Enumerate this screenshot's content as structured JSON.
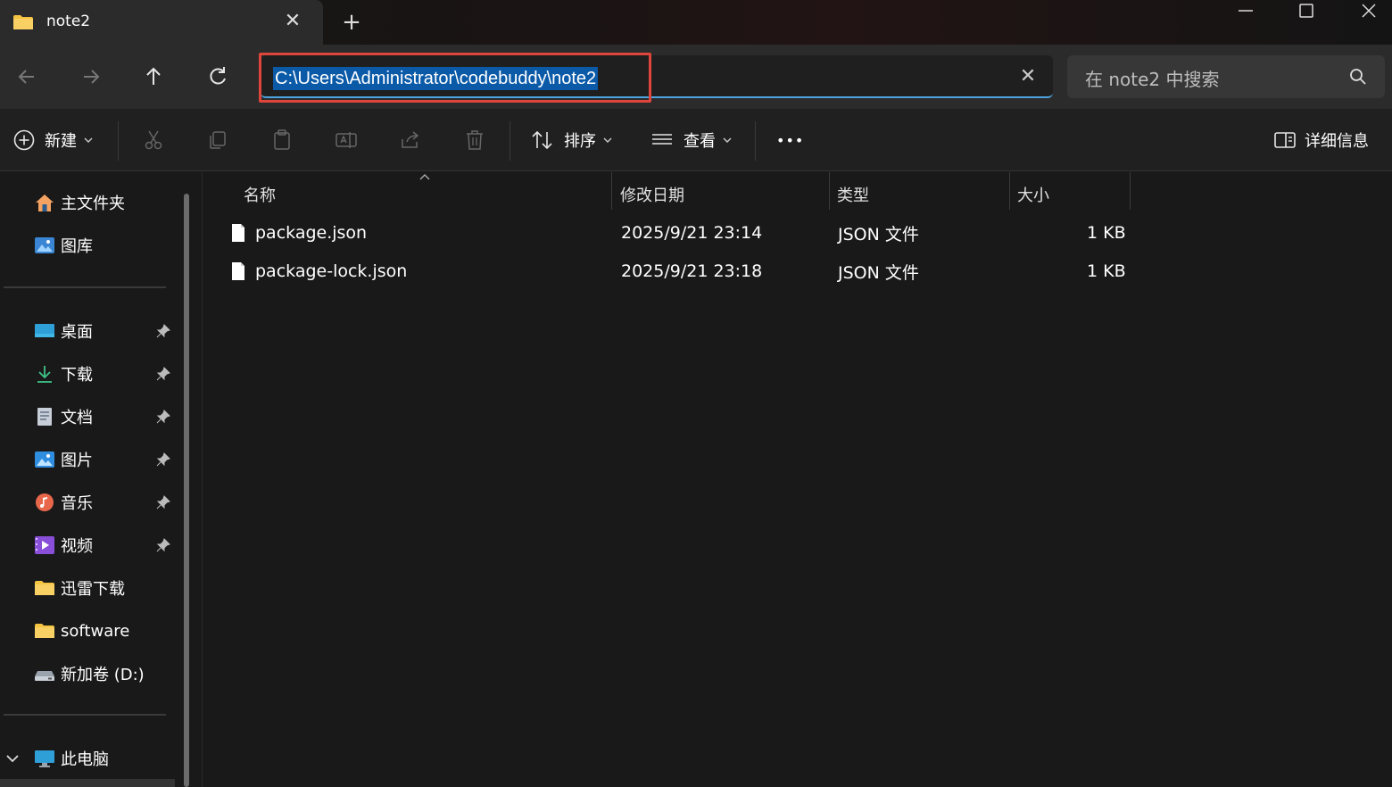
{
  "window": {
    "tab_title": "note2",
    "new_tab": "+",
    "tab_close": "✕"
  },
  "address": {
    "path": "C:\\Users\\Administrator\\codebuddy\\note2",
    "clear": "✕",
    "search_placeholder": "在 note2 中搜索"
  },
  "toolbar": {
    "new_label": "新建",
    "sort_label": "排序",
    "view_label": "查看",
    "more_label": "•••",
    "details_label": "详细信息"
  },
  "sidebar": {
    "quick": [
      {
        "label": "主文件夹",
        "icon": "home-icon"
      },
      {
        "label": "图库",
        "icon": "gallery-icon"
      }
    ],
    "pinned": [
      {
        "label": "桌面",
        "icon": "desktop-icon"
      },
      {
        "label": "下载",
        "icon": "download-icon"
      },
      {
        "label": "文档",
        "icon": "document-icon"
      },
      {
        "label": "图片",
        "icon": "pictures-icon"
      },
      {
        "label": "音乐",
        "icon": "music-icon"
      },
      {
        "label": "视频",
        "icon": "video-icon"
      }
    ],
    "folders": [
      {
        "label": "迅雷下载",
        "icon": "folder-icon"
      },
      {
        "label": "software",
        "icon": "folder-icon"
      },
      {
        "label": "新加卷 (D:)",
        "icon": "drive-icon"
      }
    ],
    "this_pc": {
      "label": "此电脑",
      "icon": "computer-icon"
    }
  },
  "filelist": {
    "columns": [
      "名称",
      "修改日期",
      "类型",
      "大小"
    ],
    "rows": [
      {
        "name": "package.json",
        "modified": "2025/9/21 23:14",
        "type": "JSON 文件",
        "size": "1 KB"
      },
      {
        "name": "package-lock.json",
        "modified": "2025/9/21 23:18",
        "type": "JSON 文件",
        "size": "1 KB"
      }
    ]
  },
  "colors": {
    "accent": "#4da3e0",
    "selection": "#0a5aa8",
    "highlight_border": "#e0453c",
    "folder": "#f5c542"
  }
}
